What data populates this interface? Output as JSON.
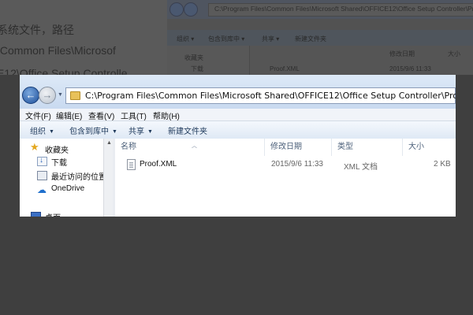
{
  "background": {
    "article_lines": [
      "系统文件，路径",
      "\\Common Files\\Microsof",
      "E12\\Office Setup Controlle"
    ],
    "window": {
      "address_path": "C:\\Program Files\\Common Files\\Microsoft Shared\\OFFICE12\\Office Setup Controller\\Proo",
      "toolbar": [
        "组织 ▾",
        "包含到库中 ▾",
        "共享 ▾",
        "新建文件夹"
      ],
      "nav_favorites": "收藏夹",
      "nav_downloads": "下载",
      "file_name": "Proof.XML",
      "date_header": "修改日期",
      "size_header": "大小",
      "file_date": "2015/9/6 11:33"
    }
  },
  "window": {
    "address_path": "C:\\Program Files\\Common Files\\Microsoft Shared\\OFFICE12\\Office Setup Controller\\Proof.en",
    "menu": [
      "文件(F)",
      "编辑(E)",
      "查看(V)",
      "工具(T)",
      "帮助(H)"
    ],
    "toolbar": {
      "organize": "组织",
      "include_in_library": "包含到库中",
      "share": "共享",
      "new_folder": "新建文件夹"
    },
    "nav": {
      "favorites": "收藏夹",
      "downloads": "下载",
      "recent_places": "最近访问的位置",
      "onedrive": "OneDrive",
      "desktop": "桌面"
    },
    "columns": {
      "name": "名称",
      "date_modified": "修改日期",
      "type": "类型",
      "size": "大小"
    },
    "files": [
      {
        "name": "Proof.XML",
        "date": "2015/9/6 11:33",
        "type": "XML 文档",
        "size": "2 KB"
      }
    ]
  }
}
